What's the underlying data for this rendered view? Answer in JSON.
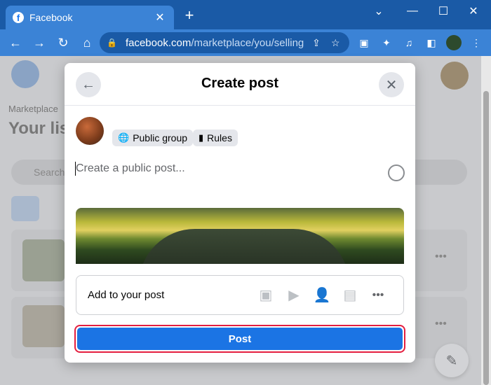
{
  "browser": {
    "tab_title": "Facebook",
    "tab_favicon": "f",
    "url_host": "facebook.com",
    "url_path": "/marketplace/you/selling"
  },
  "background": {
    "breadcrumb": "Marketplace",
    "heading": "Your lis",
    "search_placeholder": "Search"
  },
  "modal": {
    "title": "Create post",
    "chips": [
      {
        "label": "Public group",
        "icon": "globe-icon"
      },
      {
        "label": "Rules",
        "icon": "book-icon"
      }
    ],
    "composer_placeholder": "Create a public post...",
    "add_to_post_label": "Add to your post",
    "add_to_post_icons": [
      "photo-icon",
      "reel-icon",
      "tag-people-icon",
      "video-icon",
      "more-icon"
    ],
    "post_button_label": "Post"
  },
  "colors": {
    "brand_blue": "#1b74e4",
    "highlight_red": "#e41e3f"
  }
}
